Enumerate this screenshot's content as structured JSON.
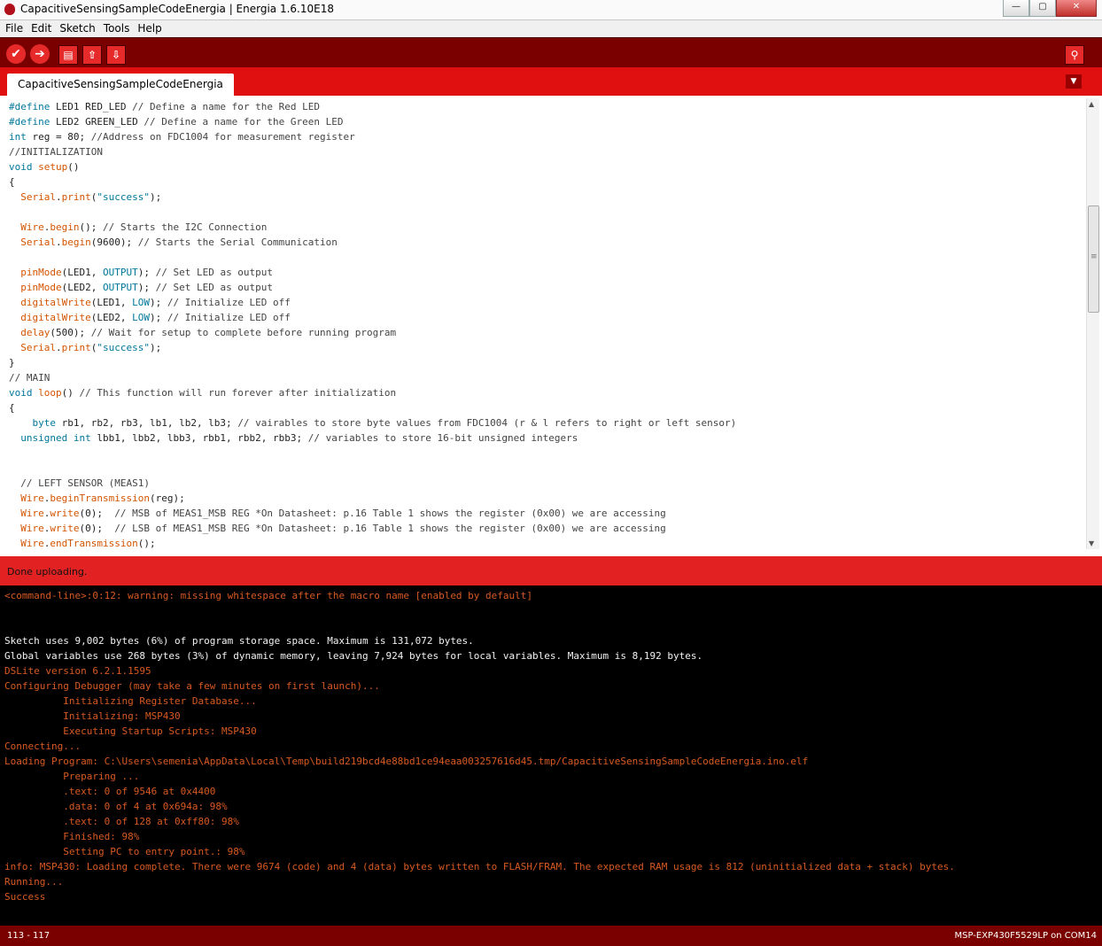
{
  "window": {
    "title": "CapacitiveSensingSampleCodeEnergia | Energia 1.6.10E18",
    "minimize": "—",
    "maximize": "▢",
    "close": "✕"
  },
  "menu": [
    "File",
    "Edit",
    "Sketch",
    "Tools",
    "Help"
  ],
  "toolbar": {
    "verify_icon": "✔",
    "upload_icon": "➔",
    "new_icon": "▤",
    "open_icon": "⇧",
    "save_icon": "⇩",
    "serial_monitor_icon": "⚲"
  },
  "tabs": [
    {
      "label": "CapacitiveSensingSampleCodeEnergia"
    }
  ],
  "tab_menu_icon": "▼",
  "editor": {
    "lines": [
      "<span class=\"kw\">#define</span> LED1 RED_LED <span class=\"cm\">// Define a name for the Red LED</span>",
      "<span class=\"kw\">#define</span> LED2 GREEN_LED <span class=\"cm\">// Define a name for the Green LED</span>",
      "<span class=\"kw\">int</span> reg = 80; <span class=\"cm\">//Address on FDC1004 for measurement register</span>",
      "<span class=\"cm\">//INITIALIZATION</span>",
      "<span class=\"kw\">void</span> <span class=\"fn\">setup</span>()",
      "{",
      "  <span class=\"fn\">Serial</span>.<span class=\"fn\">print</span>(<span class=\"str\">\"success\"</span>);",
      "",
      "  <span class=\"fn\">Wire</span>.<span class=\"fn\">begin</span>(); <span class=\"cm\">// Starts the I2C Connection</span>",
      "  <span class=\"fn\">Serial</span>.<span class=\"fn\">begin</span>(9600); <span class=\"cm\">// Starts the Serial Communication</span>",
      "",
      "  <span class=\"fn\">pinMode</span>(LED1, <span class=\"kw\">OUTPUT</span>); <span class=\"cm\">// Set LED as output</span>",
      "  <span class=\"fn\">pinMode</span>(LED2, <span class=\"kw\">OUTPUT</span>); <span class=\"cm\">// Set LED as output</span>",
      "  <span class=\"fn\">digitalWrite</span>(LED1, <span class=\"kw\">LOW</span>); <span class=\"cm\">// Initialize LED off</span>",
      "  <span class=\"fn\">digitalWrite</span>(LED2, <span class=\"kw\">LOW</span>); <span class=\"cm\">// Initialize LED off</span>",
      "  <span class=\"fn\">delay</span>(500); <span class=\"cm\">// Wait for setup to complete before running program</span>",
      "  <span class=\"fn\">Serial</span>.<span class=\"fn\">print</span>(<span class=\"str\">\"success\"</span>);",
      "}",
      "<span class=\"cm\">// MAIN</span>",
      "<span class=\"kw\">void</span> <span class=\"fn\">loop</span>() <span class=\"cm\">// This function will run forever after initialization</span>",
      "{",
      "    <span class=\"kw\">byte</span> rb1, rb2, rb3, lb1, lb2, lb3; <span class=\"cm\">// vairables to store byte values from FDC1004 (r &amp; l refers to right or left sensor)</span>",
      "  <span class=\"kw\">unsigned</span> <span class=\"kw\">int</span> lbb1, lbb2, lbb3, rbb1, rbb2, rbb3; <span class=\"cm\">// variables to store 16-bit unsigned integers</span>",
      "",
      "",
      "  <span class=\"cm\">// LEFT SENSOR (MEAS1)</span>",
      "  <span class=\"fn\">Wire</span>.<span class=\"fn\">beginTransmission</span>(reg);",
      "  <span class=\"fn\">Wire</span>.<span class=\"fn\">write</span>(0);  <span class=\"cm\">// MSB of MEAS1_MSB REG *On Datasheet: p.16 Table 1 shows the register (0x00) we are accessing</span>",
      "  <span class=\"fn\">Wire</span>.<span class=\"fn\">write</span>(0);  <span class=\"cm\">// LSB of MEAS1_MSB REG *On Datasheet: p.16 Table 1 shows the register (0x00) we are accessing</span>",
      "  <span class=\"fn\">Wire</span>.<span class=\"fn\">endTransmission</span>();"
    ]
  },
  "status": {
    "message": "Done uploading."
  },
  "console": {
    "lines": [
      {
        "cls": "c-err",
        "text": "<command-line>:0:12: warning: missing whitespace after the macro name [enabled by default]"
      },
      {
        "cls": "c-out",
        "text": ""
      },
      {
        "cls": "c-out",
        "text": ""
      },
      {
        "cls": "c-out",
        "text": "Sketch uses 9,002 bytes (6%) of program storage space. Maximum is 131,072 bytes."
      },
      {
        "cls": "c-out",
        "text": "Global variables use 268 bytes (3%) of dynamic memory, leaving 7,924 bytes for local variables. Maximum is 8,192 bytes."
      },
      {
        "cls": "c-err",
        "text": "DSLite version 6.2.1.1595"
      },
      {
        "cls": "c-err",
        "text": "Configuring Debugger (may take a few minutes on first launch)..."
      },
      {
        "cls": "c-err",
        "text": "          Initializing Register Database..."
      },
      {
        "cls": "c-err",
        "text": "          Initializing: MSP430"
      },
      {
        "cls": "c-err",
        "text": "          Executing Startup Scripts: MSP430"
      },
      {
        "cls": "c-err",
        "text": "Connecting..."
      },
      {
        "cls": "c-err",
        "text": "Loading Program: C:\\Users\\semenia\\AppData\\Local\\Temp\\build219bcd4e88bd1ce94eaa003257616d45.tmp/CapacitiveSensingSampleCodeEnergia.ino.elf"
      },
      {
        "cls": "c-err",
        "text": "          Preparing ..."
      },
      {
        "cls": "c-err",
        "text": "          .text: 0 of 9546 at 0x4400"
      },
      {
        "cls": "c-err",
        "text": "          .data: 0 of 4 at 0x694a: 98%"
      },
      {
        "cls": "c-err",
        "text": "          .text: 0 of 128 at 0xff80: 98%"
      },
      {
        "cls": "c-err",
        "text": "          Finished: 98%"
      },
      {
        "cls": "c-err",
        "text": "          Setting PC to entry point.: 98%"
      },
      {
        "cls": "c-err",
        "text": "info: MSP430: Loading complete. There were 9674 (code) and 4 (data) bytes written to FLASH/FRAM. The expected RAM usage is 812 (uninitialized data + stack) bytes."
      },
      {
        "cls": "c-err",
        "text": "Running..."
      },
      {
        "cls": "c-err",
        "text": "Success"
      }
    ]
  },
  "footer": {
    "line_range": "113 - 117",
    "board_port": "MSP-EXP430F5529LP on COM14"
  },
  "colors": {
    "toolbar_bg": "#7a0000",
    "tabbar_bg": "#e01010",
    "status_bg": "#e22222",
    "console_bg": "#000000",
    "console_error": "#d85a22"
  }
}
